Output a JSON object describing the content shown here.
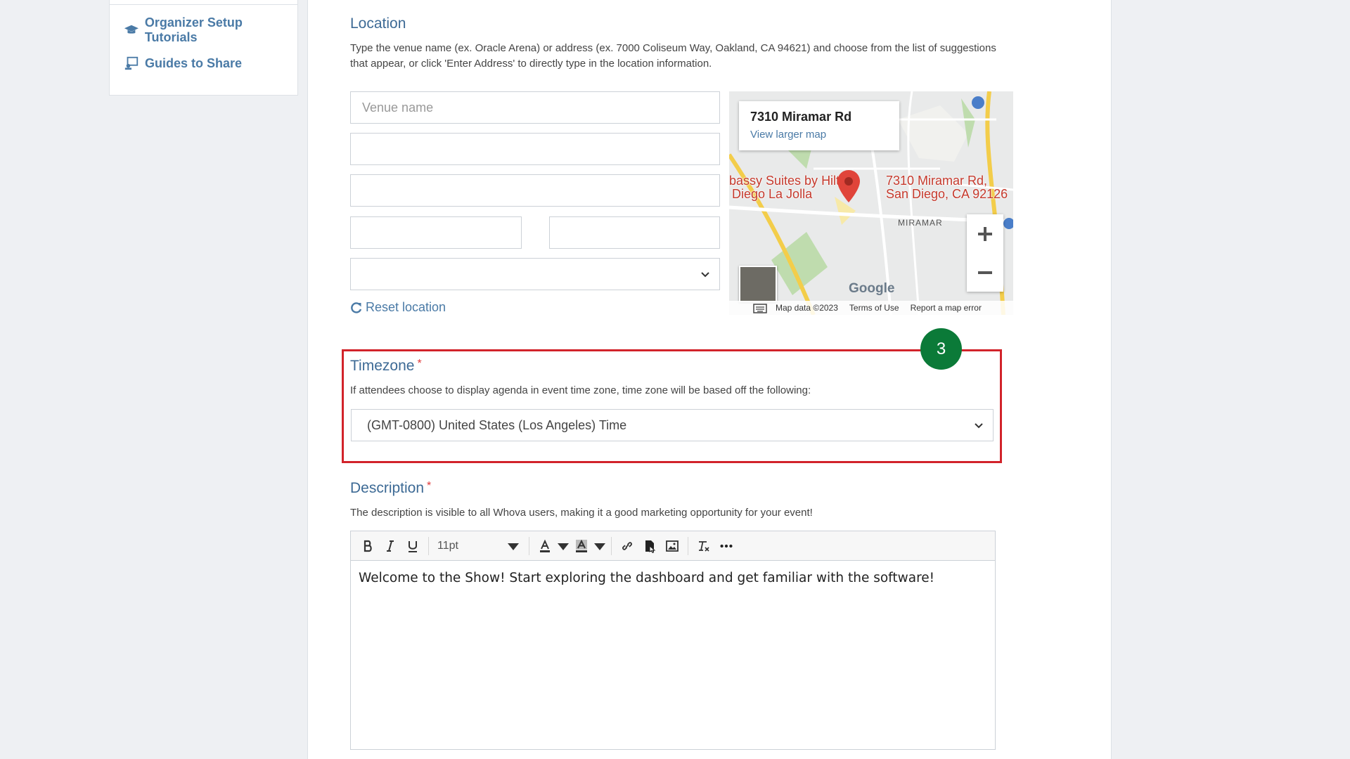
{
  "sidebar": {
    "items": [
      {
        "label": "Organizer Setup Tutorials",
        "icon": "graduation-cap-icon"
      },
      {
        "label": "Guides to Share",
        "icon": "share-guide-icon"
      }
    ]
  },
  "location": {
    "title": "Location",
    "help": "Type the venue name (ex. Oracle Arena) or address (ex. 7000 Coliseum Way, Oakland, CA 94621) and choose from the list of suggestions that appear, or click 'Enter Address' to directly type in the location information.",
    "venue_placeholder": "Venue name",
    "reset_label": "Reset location"
  },
  "map": {
    "card_address": "7310 Miramar Rd",
    "view_larger": "View larger map",
    "pin_label_line1": "7310 Miramar Rd,",
    "pin_label_line2": "San Diego, CA 92126",
    "poi_line1": "bassy Suites by Hilton",
    "poi_line2": "Diego La Jolla",
    "area_label": "MIRAMAR",
    "google": "Google",
    "footer_data": "Map data ©2023",
    "footer_terms": "Terms of Use",
    "footer_report": "Report a map error"
  },
  "timezone": {
    "title": "Timezone",
    "required_mark": "*",
    "help": "If attendees choose to display agenda in event time zone, time zone will be based off the following:",
    "selected": "(GMT-0800) United States (Los Angeles) Time",
    "step_number": "3",
    "highlight_color": "#d2232a",
    "badge_color": "#0b7a38"
  },
  "description": {
    "title": "Description",
    "required_mark": "*",
    "help": "The description is visible to all Whova users, making it a good marketing opportunity for your event!",
    "font_size": "11pt",
    "body": "Welcome to the Show! Start exploring the dashboard and get familiar with the software!"
  }
}
